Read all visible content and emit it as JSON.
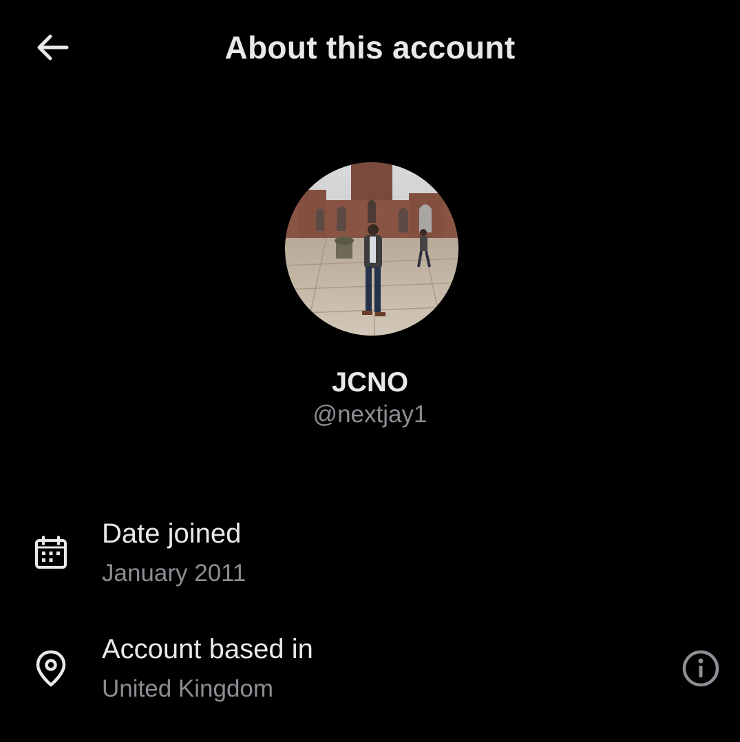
{
  "header": {
    "title": "About this account",
    "back_icon": "arrow-left-icon"
  },
  "profile": {
    "display_name": "JCNO",
    "handle": "@nextjay1",
    "avatar": "profile-photo"
  },
  "details": {
    "date_joined": {
      "label": "Date joined",
      "value": "January 2011",
      "icon": "calendar-icon"
    },
    "account_based_in": {
      "label": "Account based in",
      "value": "United Kingdom",
      "icon": "location-pin-icon",
      "info_icon": "info-icon"
    }
  },
  "colors": {
    "background": "#000000",
    "primary_text": "#e7e9ea",
    "secondary_text": "#8b8f94"
  }
}
